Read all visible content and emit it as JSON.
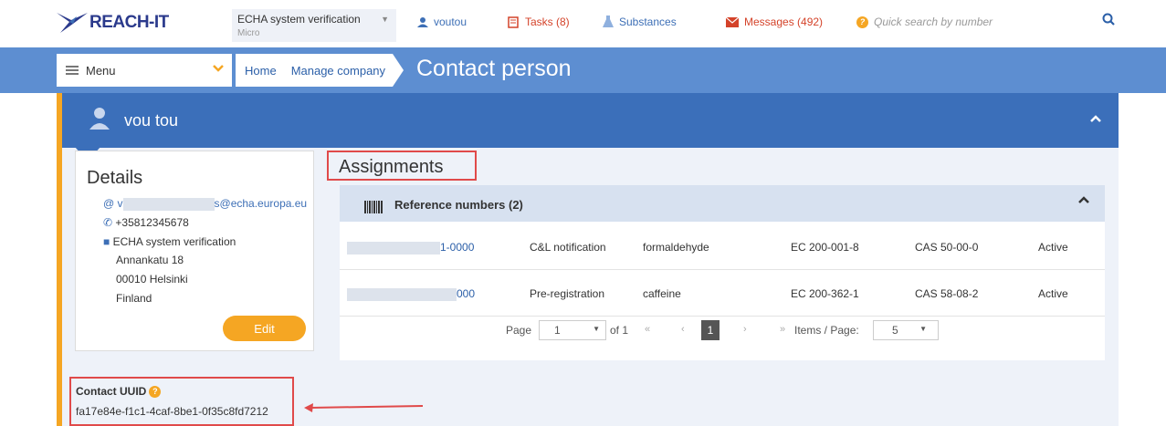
{
  "header": {
    "logo_text": "REACH-IT",
    "company_name": "ECHA system verification",
    "company_size": "Micro",
    "user": "voutou",
    "tasks": "Tasks (8)",
    "substances": "Substances",
    "messages": "Messages (492)",
    "search_placeholder": "Quick search by number"
  },
  "nav": {
    "menu_label": "Menu",
    "breadcrumbs": [
      "Home",
      "Manage company"
    ],
    "page_title": "Contact person"
  },
  "person": {
    "name": "vou tou"
  },
  "details": {
    "title": "Details",
    "email_prefix": "@ v",
    "email_suffix": "s@echa.europa.eu",
    "phone": "+35812345678",
    "organisation": "ECHA system verification",
    "address_street": "Annankatu 18",
    "address_city": "00010 Helsinki",
    "address_country": "Finland",
    "edit_label": "Edit"
  },
  "assignments": {
    "title": "Assignments",
    "reference_header": "Reference numbers (2)",
    "rows": [
      {
        "ref_suffix": "1-0000",
        "type": "C&L notification",
        "substance": "formaldehyde",
        "ec": "EC 200-001-8",
        "cas": "CAS 50-00-0",
        "status": "Active"
      },
      {
        "ref_suffix": "000",
        "type": "Pre-registration",
        "substance": "caffeine",
        "ec": "EC 200-362-1",
        "cas": "CAS 58-08-2",
        "status": "Active"
      }
    ],
    "pager": {
      "page_label": "Page",
      "page_value": "1",
      "of_label": "of 1",
      "first": "«",
      "prev": "‹",
      "current": "1",
      "next": "›",
      "last": "»",
      "items_label": "Items / Page:",
      "items_value": "5"
    }
  },
  "contact_uuid": {
    "label": "Contact UUID",
    "value": "fa17e84e-f1c1-4caf-8be1-0f35c8fd7212"
  },
  "colors": {
    "nav_blue": "#5d8ed1",
    "header_blue": "#3b6fba",
    "accent_orange": "#f5a623",
    "highlight_red": "#e04a4a"
  }
}
